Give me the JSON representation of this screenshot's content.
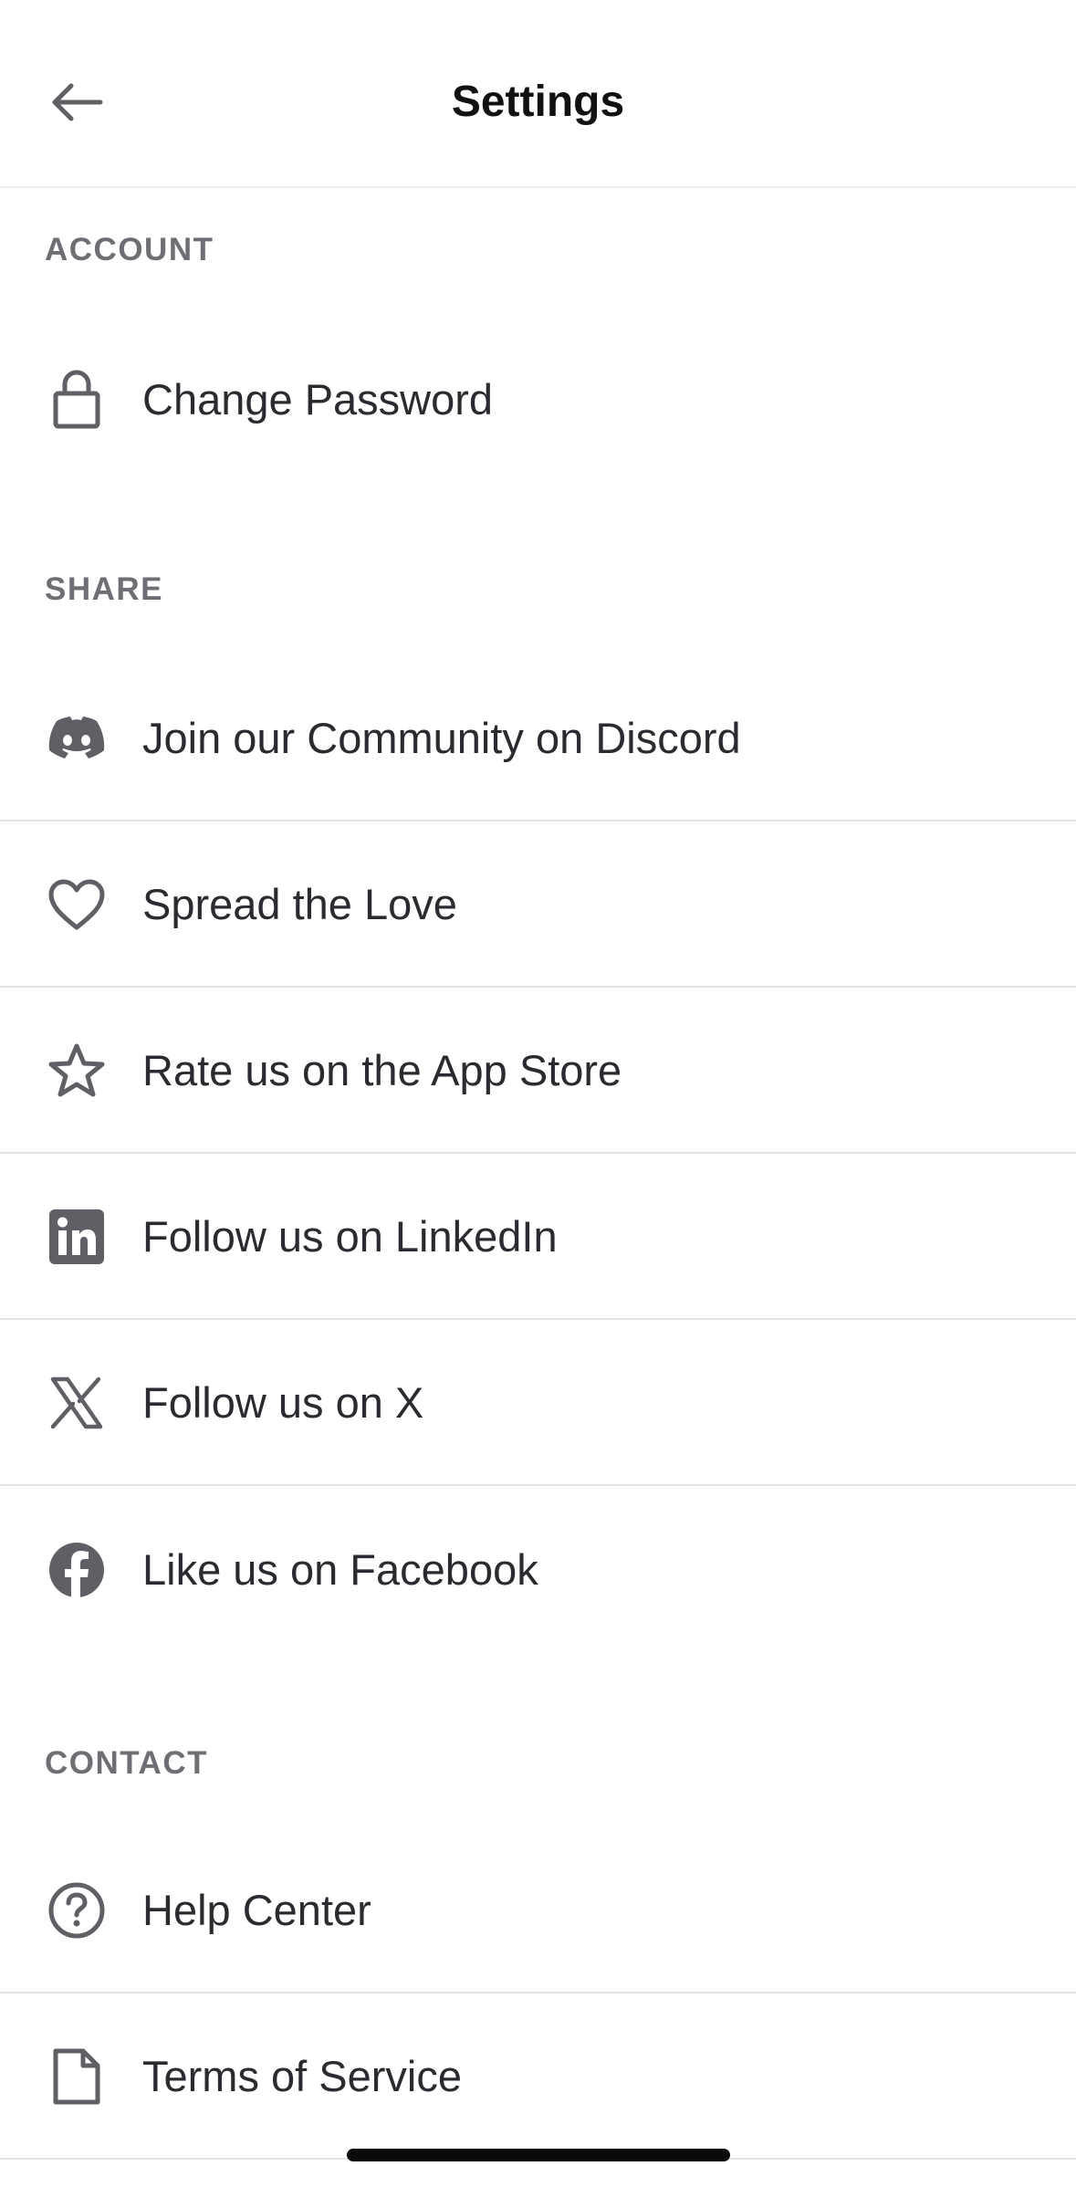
{
  "header": {
    "title": "Settings",
    "back_icon": "arrow-left-icon"
  },
  "sections": {
    "account": {
      "title": "ACCOUNT",
      "items": [
        {
          "label": "Change Password",
          "icon": "lock-icon"
        }
      ]
    },
    "share": {
      "title": "SHARE",
      "items": [
        {
          "label": "Join our Community on Discord",
          "icon": "discord-icon"
        },
        {
          "label": "Spread the Love",
          "icon": "heart-icon"
        },
        {
          "label": "Rate us on the App Store",
          "icon": "star-icon"
        },
        {
          "label": "Follow us on LinkedIn",
          "icon": "linkedin-icon"
        },
        {
          "label": "Follow us on X",
          "icon": "x-icon"
        },
        {
          "label": "Like us on Facebook",
          "icon": "facebook-icon"
        }
      ]
    },
    "contact": {
      "title": "CONTACT",
      "items": [
        {
          "label": "Help Center",
          "icon": "help-circle-icon"
        },
        {
          "label": "Terms of Service",
          "icon": "document-icon"
        }
      ]
    }
  },
  "colors": {
    "icon": "#5f5f66",
    "text": "#2a2a30",
    "section_header": "#6e6e74",
    "divider": "#e3e3e6"
  }
}
